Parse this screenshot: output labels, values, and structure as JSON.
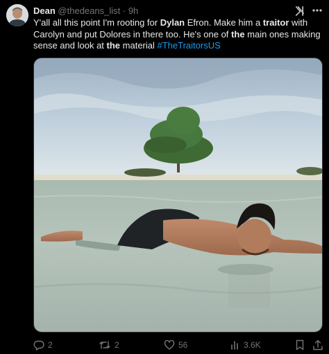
{
  "post": {
    "author_name": "Dean",
    "author_handle": "@thedeans_list",
    "separator": "·",
    "time": "9h",
    "text": {
      "t1": "Y'all all this point I'm rooting for ",
      "b1": "Dylan",
      "t2": " Efron. Make him a ",
      "b2": "traitor",
      "t3": " with Carolyn and put Dolores in there too. He's one of ",
      "b3": "the",
      "t4": " main ones making sense and look at ",
      "b4": "the",
      "t5": " material ",
      "hashtag": "#TheTraitorsUS"
    }
  },
  "actions": {
    "replies": "2",
    "reposts": "2",
    "likes": "56",
    "views": "3.6K"
  },
  "icons": {
    "reply": "reply-icon",
    "repost": "repost-icon",
    "like": "like-icon",
    "views": "views-icon",
    "bookmark": "bookmark-icon",
    "share": "share-icon",
    "grok": "grok-icon",
    "more": "more-icon"
  },
  "colors": {
    "background": "#000000",
    "text": "#e7e9ea",
    "muted": "#71767b",
    "link": "#1d9bf0"
  }
}
